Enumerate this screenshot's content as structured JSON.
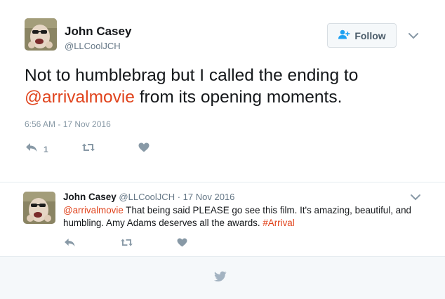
{
  "main_tweet": {
    "author_name": "John Casey",
    "author_handle": "@LLCoolJCH",
    "follow_label": "Follow",
    "text_before": "Not to humblebrag but I called the ending to ",
    "mention": "@arrivalmovie",
    "text_after": " from its opening moments.",
    "timestamp": "6:56 AM - 17 Nov 2016",
    "reply_count": "1",
    "icons": [
      "person-plus-icon",
      "chevron-down-icon",
      "reply-icon",
      "retweet-icon",
      "heart-icon"
    ]
  },
  "reply_tweet": {
    "author_name": "John Casey",
    "author_handle": "@LLCoolJCH",
    "separator": "·",
    "date": "17 Nov 2016",
    "mention": "@arrivalmovie",
    "text_body": " That being said PLEASE go see this film. It's amazing, beautiful, and humbling. Amy Adams deserves all the awards. ",
    "hashtag": "#Arrival",
    "icons": [
      "chevron-down-icon",
      "reply-icon",
      "retweet-icon",
      "heart-icon"
    ]
  },
  "footer": {
    "icon": "twitter-bird-icon"
  },
  "colors": {
    "link": "#e0431c",
    "muted": "#8899a6",
    "icon": "#8899a6",
    "footer_bg": "#f5f8fa"
  }
}
